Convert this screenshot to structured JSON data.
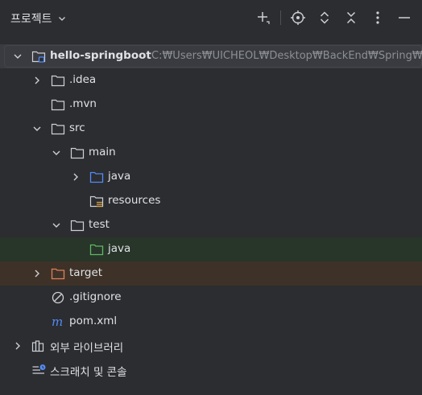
{
  "header": {
    "title": "프로젝트"
  },
  "toolbar": {
    "icons": [
      "add-icon",
      "locate-icon",
      "expand-collapse-icon",
      "collapse-all-icon",
      "more-options-icon",
      "hide-icon"
    ]
  },
  "tree": {
    "project": {
      "name": "hello-springboot",
      "path": "C:₩Users₩UICHEOL₩Desktop₩BackEnd₩Spring₩"
    },
    "idea": "idea",
    "idea_dot": ".idea",
    "mvn": ".mvn",
    "src": "src",
    "main": "main",
    "main_java": "java",
    "resources": "resources",
    "test": "test",
    "test_java": "java",
    "target": "target",
    "gitignore": ".gitignore",
    "pom": "pom.xml",
    "external_libraries": "외부 라이브러리",
    "scratches": "스크래치 및 콘솔"
  },
  "colors": {
    "background": "#2b2d30",
    "text": "#dfe1e5",
    "path_text": "#8c8f94",
    "source_folder": "#548af7",
    "test_folder": "#5fb865",
    "excluded_folder": "#e0805a",
    "selected_row": "#393b40",
    "test_row": "#283529",
    "excluded_row": "#3e3228"
  }
}
